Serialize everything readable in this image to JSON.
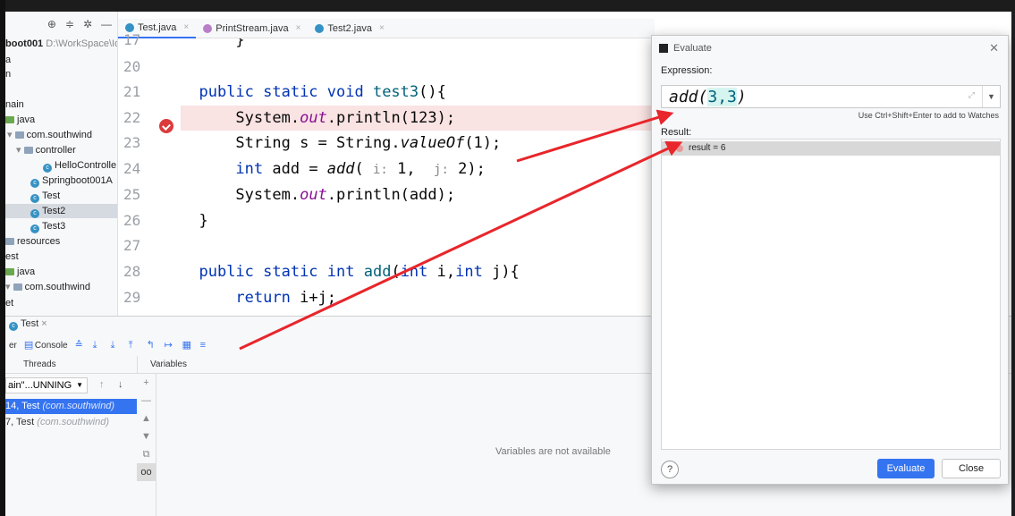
{
  "project": {
    "root_label": "boot001",
    "root_path": "D:\\WorkSpace\\Id",
    "items": [
      "a",
      "n",
      "nain",
      "java",
      "com.southwind",
      "controller",
      "HelloControlle",
      "Springboot001A",
      "Test",
      "Test2",
      "Test3",
      "resources",
      "est",
      "java",
      "com.southwind",
      "et"
    ]
  },
  "tabs": [
    {
      "label": "Test.java",
      "active": true
    },
    {
      "label": "PrintStream.java",
      "active": false
    },
    {
      "label": "Test2.java",
      "active": false
    }
  ],
  "gutter": {
    "line_numbers": [
      "17",
      "20",
      "21",
      "22",
      "23",
      "24",
      "25",
      "26",
      "27",
      "28",
      "29"
    ]
  },
  "code": {
    "l21_kw": "public static void ",
    "l21_fn": "test3",
    "l21_rest": "(){",
    "l22_a": "System.",
    "l22_out": "out",
    "l22_b": ".println(123);",
    "l23_a": "String s = String.",
    "l23_it": "valueOf",
    "l23_b": "(1);",
    "l24_kw": "int",
    "l24_a": " add = ",
    "l24_it": "add",
    "l24_b": "( ",
    "l24_hi": "i:",
    "l24_c": " 1,  ",
    "l24_hj": "j:",
    "l24_d": " 2);",
    "l25_a": "System.",
    "l25_out": "out",
    "l25_b": ".println(add);",
    "l26": "}",
    "l28_kw": "public static int ",
    "l28_fn": "add",
    "l28_p1": "(",
    "l28_kw2": "int",
    "l28_p2": " i,",
    "l28_kw3": "int",
    "l28_p3": " j){",
    "l29_kw": "return",
    "l29_rest": " i+j;"
  },
  "debug": {
    "title": "Test",
    "tab_left": "er",
    "tab_console": "Console",
    "threads_label": "Threads",
    "variables_label": "Variables",
    "thread_select": "ain\"...UNNING",
    "frames": [
      {
        "name": "14, Test",
        "pkg": "(com.southwind)",
        "selected": true
      },
      {
        "name": "7, Test",
        "pkg": "(com.southwind)",
        "selected": false
      }
    ],
    "vars_empty": "Variables are not available"
  },
  "evaluate": {
    "title": "Evaluate",
    "expression_label": "Expression:",
    "expression_fn": "add(",
    "expression_args": "3,3",
    "expression_close": ")",
    "hint": "Use Ctrl+Shift+Enter to add to Watches",
    "result_label": "Result:",
    "result_text": "result = 6",
    "evaluate_button": "Evaluate",
    "close_button": "Close",
    "help": "?"
  },
  "colors": {
    "accent": "#3574f0",
    "breakpoint": "#db3b3b",
    "arrow": "#e8262b"
  }
}
